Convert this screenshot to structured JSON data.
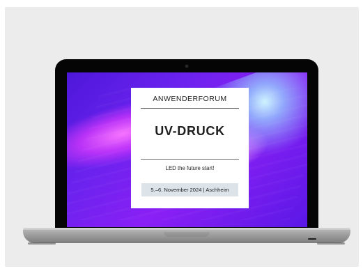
{
  "card": {
    "header": "ANWENDERFORUM",
    "title": "UV-DRUCK",
    "subtitle": "LED the future start!",
    "date": "5.–6. November 2024 | Aschheim"
  }
}
